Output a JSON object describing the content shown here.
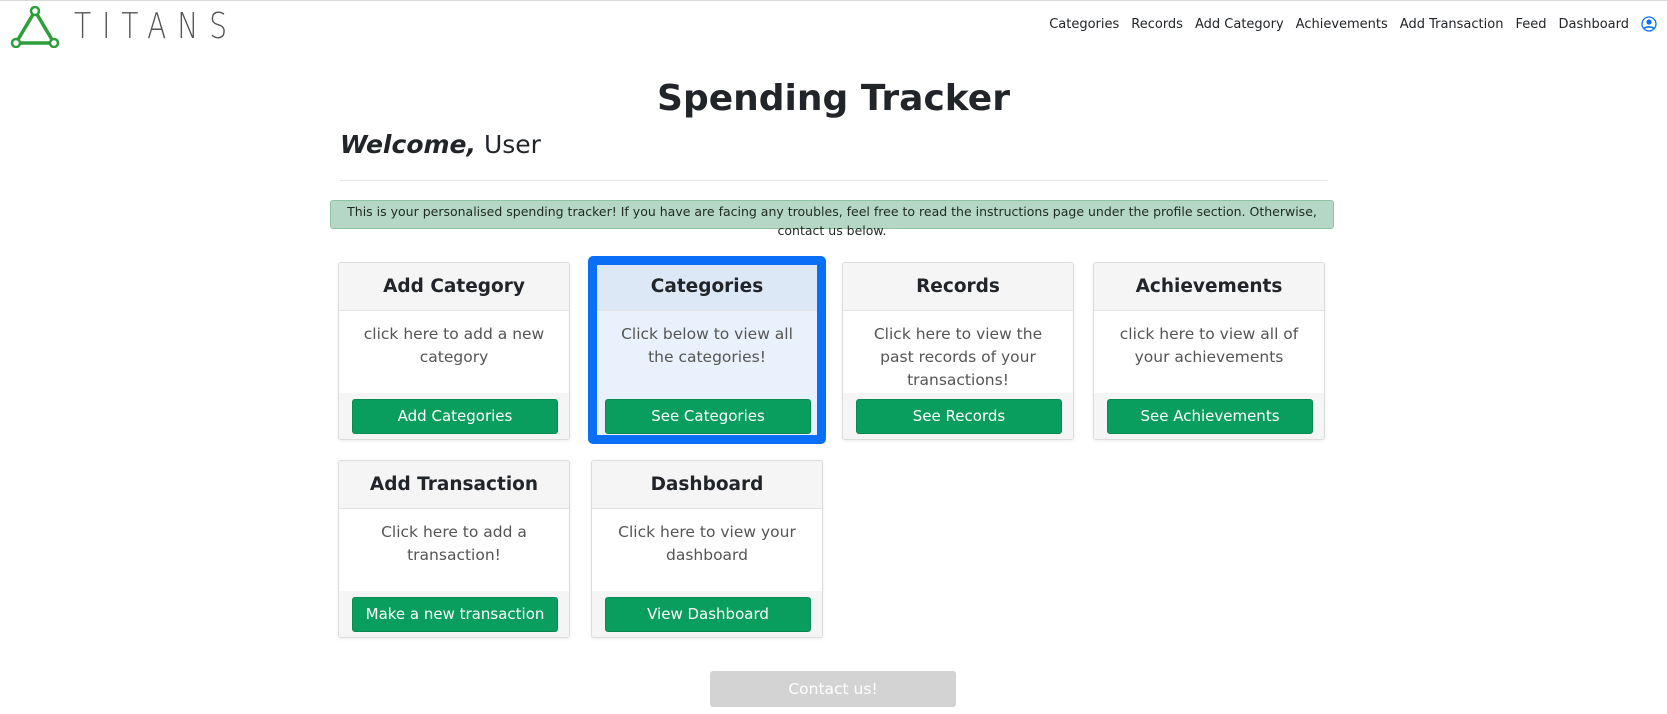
{
  "brand": {
    "name": "TITANS",
    "color": "#2e9e3a",
    "logo_icon": "triangle-logo-icon"
  },
  "nav": {
    "links": [
      "Categories",
      "Records",
      "Add Category",
      "Achievements",
      "Add Transaction",
      "Feed",
      "Dashboard"
    ],
    "user_icon": "user-circle-icon"
  },
  "page": {
    "title": "Spending Tracker",
    "welcome_word": "Welcome,",
    "welcome_name": " User",
    "alert": "This is your personalised spending tracker! If you have are facing any troubles, feel free to read the instructions page under the profile section. Otherwise, contact us below."
  },
  "cards": [
    {
      "title": "Add Category",
      "text": "click here to add a new category",
      "button": "Add Categories"
    },
    {
      "title": "Categories",
      "text": "Click below to view all the categories!",
      "button": "See Categories",
      "selected": true
    },
    {
      "title": "Records",
      "text": "Click here to view the past records of your transactions!",
      "button": "See Records"
    },
    {
      "title": "Achievements",
      "text": "click here to view all of your achievements",
      "button": "See Achievements"
    },
    {
      "title": "Add Transaction",
      "text": "Click here to add a transaction!",
      "button": "Make a new transaction"
    },
    {
      "title": "Dashboard",
      "text": "Click here to view your dashboard",
      "button": "View Dashboard"
    }
  ],
  "contact": {
    "label": "Contact us!"
  },
  "colors": {
    "button_green": "#0a9e5e",
    "alert_bg": "#b5d7c5",
    "focus_blue": "#0b6ef6",
    "contact_disabled": "#d3d3d3"
  }
}
